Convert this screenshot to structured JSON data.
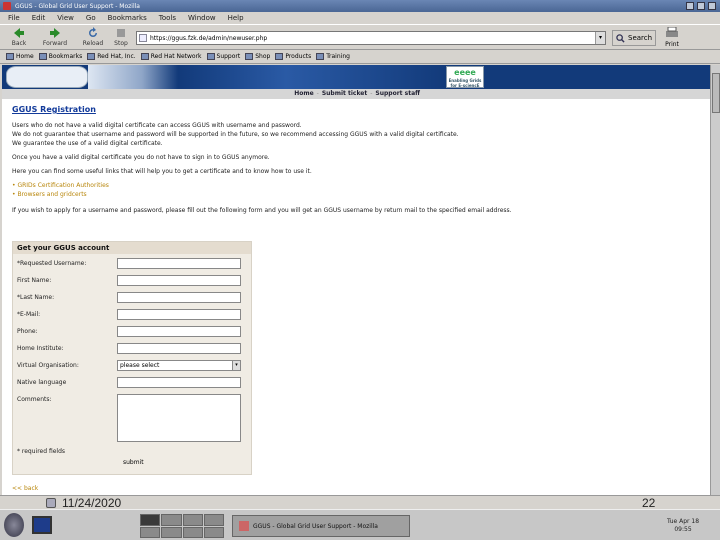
{
  "window": {
    "title": "GGUS - Global Grid User Support - Mozilla"
  },
  "menu": [
    "File",
    "Edit",
    "View",
    "Go",
    "Bookmarks",
    "Tools",
    "Window",
    "Help"
  ],
  "nav": {
    "back": "Back",
    "forward": "Forward",
    "reload": "Reload",
    "stop": "Stop",
    "url": "https://ggus.fzk.de/admin/newuser.php",
    "search": "Search",
    "print": "Print"
  },
  "personal_toolbar": [
    "Home",
    "Bookmarks",
    "Red Hat, Inc.",
    "Red Hat Network",
    "Support",
    "Shop",
    "Products",
    "Training"
  ],
  "site": {
    "egee": "eeee",
    "egee_sub": "Enabling Grids for E-sciencE",
    "topnav": [
      "Home",
      "Submit ticket",
      "Support staff"
    ]
  },
  "page": {
    "title": "GGUS Registration",
    "paragraphs": [
      "Users who do not have a valid digital certificate can access GGUS with username and password.",
      "We do not guarantee that username and password will be supported in the future, so we recommend accessing GGUS with a valid digital certificate.",
      "We guarantee the use of a valid digital certificate.",
      "Once you have a valid digital certificate you do not have to sign in to GGUS anymore.",
      "Here you can find some useful links that will help you to get a certificate and to know how to use it."
    ],
    "links": [
      "GRIDs Certification Authorities",
      "Browsers and gridcerts"
    ],
    "apply_text": "If you wish to apply for a username and password, please fill out the following form and you will get an GGUS username by return mail to the specified email address."
  },
  "form": {
    "heading": "Get your GGUS account",
    "fields": [
      "*Requested Username:",
      "First Name:",
      "*Last Name:",
      "*E-Mail:",
      "Phone:",
      "Home Institute:",
      "Virtual Organisation:",
      "Native language",
      "Comments:"
    ],
    "vo_select": "please select",
    "required_note": "* required fields",
    "submit": "submit"
  },
  "back_link": "<< back",
  "overlay": {
    "date": "11/24/2020",
    "slide": "22"
  },
  "taskbar": {
    "task": "GGUS - Global Grid User Support - Mozilla",
    "clock_day": "Tue Apr 18",
    "clock_time": "09:55"
  }
}
